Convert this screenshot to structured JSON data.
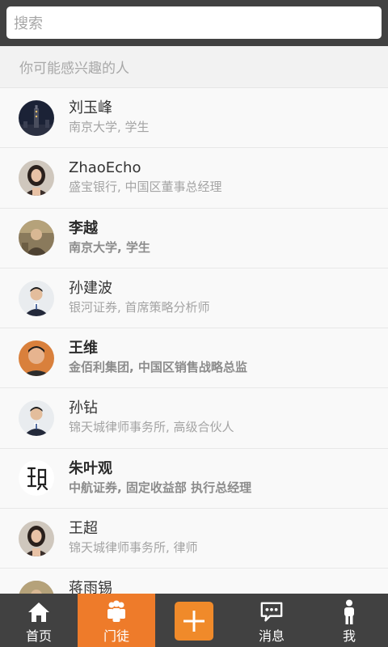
{
  "search": {
    "placeholder": "搜索"
  },
  "section_header": "你可能感兴趣的人",
  "people": [
    {
      "name": "刘玉峰",
      "desc": "南京大学, 学生",
      "bold": false,
      "avatar": "night-building-photo"
    },
    {
      "name": "ZhaoEcho",
      "desc": "盛宝银行, 中国区董事总经理",
      "bold": false,
      "avatar": "woman-portrait"
    },
    {
      "name": "李越",
      "desc": "南京大学, 学生",
      "bold": true,
      "avatar": "person-photo"
    },
    {
      "name": "孙建波",
      "desc": "银河证券, 首席策略分析师",
      "bold": false,
      "avatar": "man-suit-portrait"
    },
    {
      "name": "王维",
      "desc": "金佰利集团, 中国区销售战略总监",
      "bold": true,
      "avatar": "man-portrait"
    },
    {
      "name": "孙钻",
      "desc": "锦天城律师事务所, 高级合伙人",
      "bold": false,
      "avatar": "man-suit-portrait"
    },
    {
      "name": "朱叶观",
      "desc": "中航证券, 固定收益部 执行总经理",
      "bold": true,
      "avatar": "calligraphy-logo"
    },
    {
      "name": "王超",
      "desc": "锦天城律师事务所, 律师",
      "bold": false,
      "avatar": "woman-portrait"
    },
    {
      "name": "蒋雨锡",
      "desc": "",
      "bold": false,
      "avatar": "person-photo"
    }
  ],
  "tabs": [
    {
      "label": "首页",
      "icon": "home-icon",
      "active": false
    },
    {
      "label": "门徒",
      "icon": "people-icon",
      "active": true
    },
    {
      "label": "",
      "icon": "plus-icon",
      "active": false
    },
    {
      "label": "消息",
      "icon": "chat-bubble-icon",
      "active": false
    },
    {
      "label": "我",
      "icon": "person-icon",
      "active": false
    }
  ],
  "colors": {
    "topbar": "#414141",
    "accent": "#ee7b2a",
    "plus": "#f08a2a"
  }
}
